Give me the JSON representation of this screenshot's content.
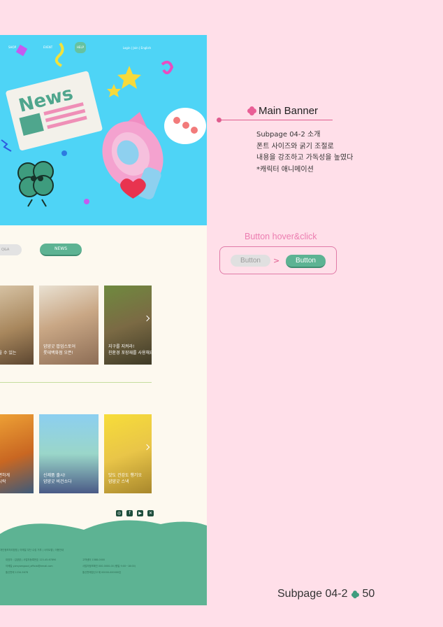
{
  "nav": {
    "shop": "SHOP",
    "event": "EVENT",
    "help": "HELP",
    "login": "Login | Join | English"
  },
  "banner": {
    "news_label": "News"
  },
  "tabs": {
    "qa": "Q&A",
    "news": "NEWS"
  },
  "news_cards": [
    {
      "caption": "먹을 수 있는"
    },
    {
      "caption": "얌얌굿 팝업스토어\n롯데백화점 오픈!"
    },
    {
      "caption": "지구를 지켜라!\n친환경 포장재를 사용해요"
    }
  ],
  "product_cards": [
    {
      "caption": "간편하게\n도시락"
    },
    {
      "caption": "신제품 출시!\n얌얌굿 비건소다"
    },
    {
      "caption": "맛도 건강도 챙기오\n얌얌굿 스낵"
    }
  ],
  "footer": {
    "links": "개인정보처리방침 | 이메일 무단 수집 거부 | 사이트맵 | 이용안내",
    "row1_left": "대표자 : 김얌얌 | 사업자등록번호 123-45-67890",
    "row1_right": "고객센터 1588-0000",
    "row2_left": "이메일    yamyamgood_official@email.com",
    "row2_right": "사업자정보확인  000-0000-00 (평일 9:00~18:00)",
    "row3_left": "통신판매    1234-5678",
    "row3_right": "통신판매업신고  제 00000-000000호"
  },
  "annotation": {
    "title": "Main Banner",
    "body": [
      "Subpage 04-2 소개",
      "폰트 사이즈와 굵기 조절로",
      "내용을 강조하고 가독성을 높였다",
      "*캐릭터 애니메이션"
    ]
  },
  "button_demo": {
    "title": "Button hover&click",
    "before": "Button",
    "after": "Button",
    "arrow": ">"
  },
  "page": {
    "label": "Subpage 04-2",
    "number": "50"
  },
  "colors": {
    "accent_pink": "#e05c8e",
    "brand_green": "#5db393",
    "banner_blue": "#4ed4f6",
    "background": "#ffdfe9"
  }
}
